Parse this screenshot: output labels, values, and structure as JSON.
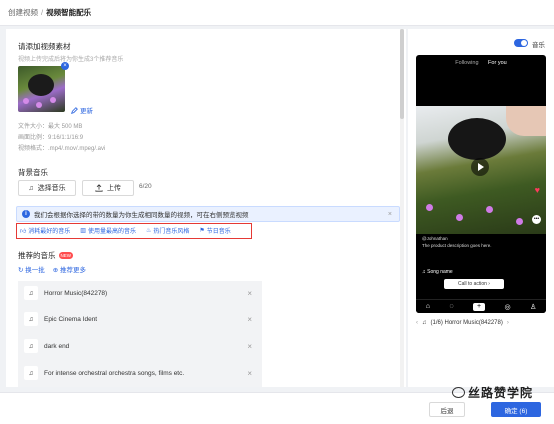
{
  "breadcrumb": {
    "parent": "创建视频",
    "separator": "/",
    "current": "视频智能配乐"
  },
  "material": {
    "title": "请添加视频素材",
    "hint": "视频上传完成后将为你生成3个推荐音乐",
    "update_label": "更新",
    "specs": [
      "文件大小：最大 500 MB",
      "画面比例：9:16/1:1/16:9",
      "视频格式：.mp4/.mov/.mpeg/.avi"
    ]
  },
  "background_music": {
    "title": "背景音乐",
    "select_label": "选择音乐",
    "upload_label": "上传",
    "count": "6/20"
  },
  "info_banner": {
    "text": "我们会根据你选择的带的数量为你生成相同数量的视频，可在右侧预览视频"
  },
  "chips": [
    "消耗最好的音乐",
    "使用量最高的音乐",
    "热门音乐风格",
    "节日音乐"
  ],
  "recommended": {
    "title": "推荐的音乐",
    "new_badge": "NEW",
    "refresh_label": "换一批",
    "more_label": "推荐更多",
    "items": [
      "Horror Music(842278)",
      "Epic Cinema Ident",
      "dark end",
      "For intense orchestral orchestra songs, films etc."
    ]
  },
  "preview": {
    "toggle_label": "音乐",
    "tabs": [
      "Following",
      "For you"
    ],
    "caption_user": "@Johnathan",
    "caption_text": "The product description goes here.",
    "song_label": "Song name",
    "cta_label": "Call to action",
    "pager_text": "(1/6) Horror Music(842278)"
  },
  "footer": {
    "back_label": "后退",
    "confirm_label": "确定 (6)"
  },
  "watermark": "丝路赞学院",
  "colors": {
    "accent": "#2d66e0",
    "highlight_border": "#e53935",
    "new_badge": "#ff4d4f"
  }
}
